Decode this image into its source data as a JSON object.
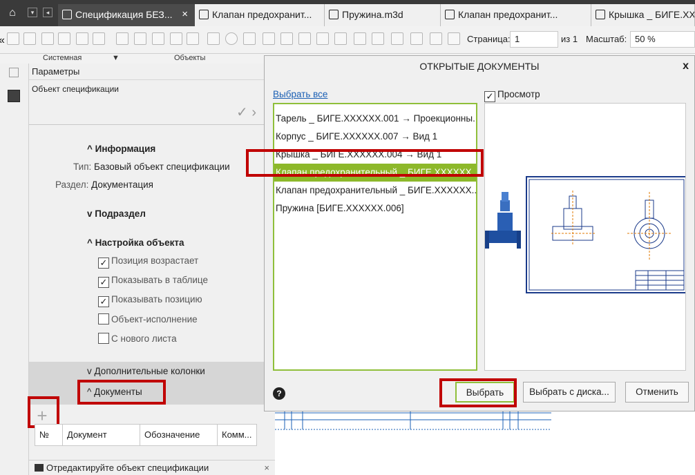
{
  "tabs": [
    {
      "label": "Спецификация БЕЗ...",
      "close": "×"
    },
    {
      "label": "Клапан предохранит..."
    },
    {
      "label": "Пружина.m3d"
    },
    {
      "label": "Клапан предохранит..."
    },
    {
      "label": "Крышка _ БИГЕ.ХХХ"
    }
  ],
  "tab_left_glyph": "«",
  "toolbar": {
    "page_label": "Страница:",
    "page_value": "1",
    "page_of": "из 1",
    "scale_label": "Масштаб:",
    "scale_value": "50 %",
    "group1": "Системная",
    "group2": "Объекты"
  },
  "params": {
    "header": "Параметры",
    "object_label": "Объект спецификации",
    "check_glyph": "✓ ›",
    "info": {
      "title": "Информация",
      "type_key": "Тип:",
      "type_value": "Базовый объект спецификации",
      "section_key": "Раздел:",
      "section_value": "Документация"
    },
    "subsection": "Подраздел",
    "object_setup": {
      "title": "Настройка объекта",
      "options": [
        {
          "label": "Позиция возрастает",
          "checked": true
        },
        {
          "label": "Показывать в таблице",
          "checked": true
        },
        {
          "label": "Показывать позицию",
          "checked": true
        },
        {
          "label": "Объект-исполнение",
          "checked": false
        },
        {
          "label": "С нового листа",
          "checked": false
        }
      ]
    },
    "extra_columns": "Дополнительные колонки",
    "documents": "Документы",
    "add_glyph": "+",
    "table_columns": [
      "№",
      "Документ",
      "Обозначение",
      "Комм..."
    ],
    "hint": "Отредактируйте объект спецификации",
    "hint_close": "×"
  },
  "dialog": {
    "title": "ОТКРЫТЫЕ ДОКУМЕНТЫ",
    "close": "x",
    "select_all": "Выбрать все",
    "preview_label": "Просмотр",
    "preview_checked": true,
    "items": [
      {
        "label": "Тарель _ БИГЕ.XXXXXX.001 → Проекционны...",
        "selected": false
      },
      {
        "label": "Корпус _ БИГЕ.XXXXXX.007 → Вид 1",
        "selected": false
      },
      {
        "label": "Крышка _ БИГЕ.XXXXXX.004 → Вид 1",
        "selected": false
      },
      {
        "label": "Клапан предохранительный _ БИГЕ.XXXXXX....",
        "selected": true
      },
      {
        "label": "Клапан предохранительный _ БИГЕ.XXXXXX....",
        "selected": false
      },
      {
        "label": "Пружина [БИГЕ.XXXXXX.006]",
        "selected": false
      }
    ],
    "help": "?",
    "buttons": {
      "select": "Выбрать",
      "select_from_disk": "Выбрать с диска...",
      "cancel": "Отменить"
    }
  },
  "colors": {
    "accent_green": "#8db82a",
    "highlight_red": "#c00000",
    "link_blue": "#1a5fb4"
  }
}
